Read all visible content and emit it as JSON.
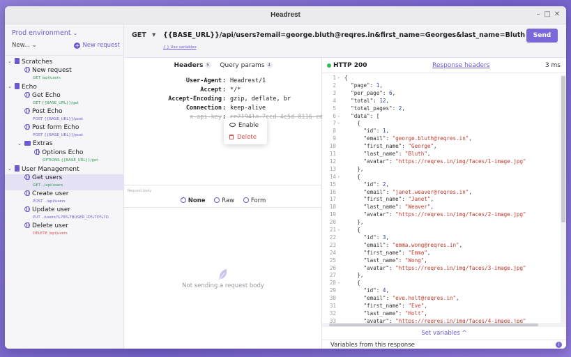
{
  "window": {
    "title": "Headrest"
  },
  "sidebar": {
    "environment": "Prod environment",
    "new_label": "New...",
    "new_request_label": "New request",
    "tree": [
      {
        "name": "Scratches",
        "type": "collection",
        "depth": 0,
        "expanded": true
      },
      {
        "name": "New request",
        "type": "request",
        "depth": 1,
        "method": "GET",
        "path": "/api/users"
      },
      {
        "name": "Echo",
        "type": "collection",
        "depth": 0,
        "expanded": true
      },
      {
        "name": "Get Echo",
        "type": "request",
        "depth": 1,
        "method": "GET",
        "path": "{{BASE_URL}}/get"
      },
      {
        "name": "Post Echo",
        "type": "request",
        "depth": 1,
        "method": "POST",
        "path": "{{BASE_URL}}/post"
      },
      {
        "name": "Post form Echo",
        "type": "request",
        "depth": 1,
        "method": "POST",
        "path": "{{BASE_URL}}/post"
      },
      {
        "name": "Extras",
        "type": "folder",
        "depth": 1,
        "expanded": true
      },
      {
        "name": "Options Echo",
        "type": "request",
        "depth": 2,
        "method": "OPTIONS",
        "path": "{{BASE_URL}}/get"
      },
      {
        "name": "User Management",
        "type": "collection",
        "depth": 0,
        "expanded": true
      },
      {
        "name": "Get users",
        "type": "request",
        "depth": 1,
        "method": "GET",
        "path": "../api/users",
        "selected": true
      },
      {
        "name": "Create user",
        "type": "request",
        "depth": 1,
        "method": "POST",
        "path": "../api/users"
      },
      {
        "name": "Update user",
        "type": "request",
        "depth": 1,
        "method": "PUT",
        "path": "../users/%7B%7BUSER_ID%7D%7D"
      },
      {
        "name": "Delete user",
        "type": "request",
        "depth": 1,
        "method": "DELETE",
        "path": "/api/users"
      }
    ]
  },
  "request": {
    "method": "GET",
    "url": "{{BASE_URL}}/api/users?email=george.bluth@reqres.in&first_name=Georges&last_name=Bluth",
    "use_variables": "{ } Use variables",
    "send_label": "Send",
    "tabs": [
      {
        "label": "Headers",
        "count": "5",
        "active": true
      },
      {
        "label": "Query params",
        "count": "4",
        "active": false
      }
    ],
    "headers": [
      {
        "key": "User-Agent",
        "value": "Headrest/1",
        "enabled": true
      },
      {
        "key": "Accept",
        "value": "*/*",
        "enabled": true
      },
      {
        "key": "Accept-Encoding",
        "value": "gzip, deflate, br",
        "enabled": true
      },
      {
        "key": "Connection",
        "value": "keep-alive",
        "enabled": true
      },
      {
        "key": "x-api-key",
        "value": "ce21941a-7ccd-4c5d-8116-cd",
        "enabled": false
      }
    ],
    "context_menu": {
      "enable": "Enable",
      "delete": "Delete"
    },
    "body_label": "Request body",
    "body_options": [
      {
        "label": "None",
        "selected": true
      },
      {
        "label": "Raw",
        "selected": false
      },
      {
        "label": "Form",
        "selected": false
      }
    ],
    "empty_body_text": "Not sending a request body"
  },
  "response": {
    "status": "HTTP 200",
    "headers_link": "Response headers",
    "time": "3 ms",
    "set_variables": "Set variables ^",
    "variables_label": "Variables from this response",
    "lines": [
      {
        "n": "1",
        "fold": "v",
        "t": "{"
      },
      {
        "n": "2",
        "t": "  \"page\": 1,"
      },
      {
        "n": "3",
        "t": "  \"per_page\": 6,"
      },
      {
        "n": "4",
        "t": "  \"total\": 12,"
      },
      {
        "n": "5",
        "t": "  \"total_pages\": 2,"
      },
      {
        "n": "6",
        "fold": "v",
        "t": "  \"data\": ["
      },
      {
        "n": "7",
        "fold": "v",
        "t": "    {"
      },
      {
        "n": "8",
        "t": "      \"id\": 1,"
      },
      {
        "n": "9",
        "t": "      \"email\": \"george.bluth@reqres.in\","
      },
      {
        "n": "10",
        "t": "      \"first_name\": \"George\","
      },
      {
        "n": "11",
        "t": "      \"last_name\": \"Bluth\","
      },
      {
        "n": "12",
        "t": "      \"avatar\": \"https://reqres.in/img/faces/1-image.jpg\""
      },
      {
        "n": "13",
        "t": "    },"
      },
      {
        "n": "14",
        "fold": "v",
        "t": "    {"
      },
      {
        "n": "15",
        "t": "      \"id\": 2,"
      },
      {
        "n": "16",
        "t": "      \"email\": \"janet.weaver@reqres.in\","
      },
      {
        "n": "17",
        "t": "      \"first_name\": \"Janet\","
      },
      {
        "n": "18",
        "t": "      \"last_name\": \"Weaver\","
      },
      {
        "n": "19",
        "t": "      \"avatar\": \"https://reqres.in/img/faces/2-image.jpg\""
      },
      {
        "n": "20",
        "t": "    },"
      },
      {
        "n": "21",
        "fold": "v",
        "t": "    {"
      },
      {
        "n": "22",
        "t": "      \"id\": 3,"
      },
      {
        "n": "23",
        "t": "      \"email\": \"emma.wong@reqres.in\","
      },
      {
        "n": "24",
        "t": "      \"first_name\": \"Emma\","
      },
      {
        "n": "25",
        "t": "      \"last_name\": \"Wong\","
      },
      {
        "n": "26",
        "t": "      \"avatar\": \"https://reqres.in/img/faces/3-image.jpg\""
      },
      {
        "n": "27",
        "t": "    },"
      },
      {
        "n": "28",
        "fold": "v",
        "t": "    {"
      },
      {
        "n": "29",
        "t": "      \"id\": 4,"
      },
      {
        "n": "30",
        "t": "      \"email\": \"eve.holt@reqres.in\","
      },
      {
        "n": "31",
        "t": "      \"first_name\": \"Eve\","
      },
      {
        "n": "32",
        "t": "      \"last_name\": \"Holt\","
      },
      {
        "n": "33",
        "t": "      \"avatar\": \"https://reqres.in/img/faces/4-image.jpg\""
      }
    ]
  },
  "colors": {
    "accent": "#6b5bd2",
    "success": "#2fbf5a",
    "danger": "#d9534f",
    "get": "#2f9a52"
  }
}
